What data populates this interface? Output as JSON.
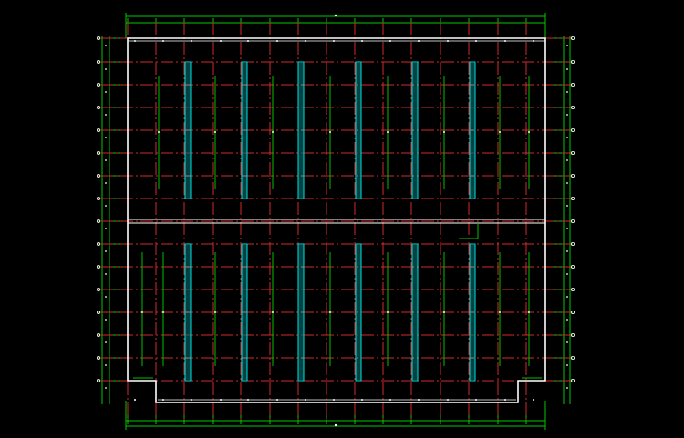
{
  "drawing": {
    "background_color": "#000000",
    "colors": {
      "dimension_lines": "#00c800",
      "grid_axis_lines": "#d42a2a",
      "wall_outline": "#ffffff",
      "column_lights": "#00e0e0",
      "fixture_lines": "#00c000",
      "marker_dots": "#ffffff"
    },
    "layout_description_icons": [
      "grid-bubble-icon"
    ],
    "vertical_grid_count": 15,
    "horizontal_grid_count": 16,
    "light_bar_columns": 6,
    "light_bar_rows": 2,
    "side_fixture_lines_per_bay": 2
  }
}
